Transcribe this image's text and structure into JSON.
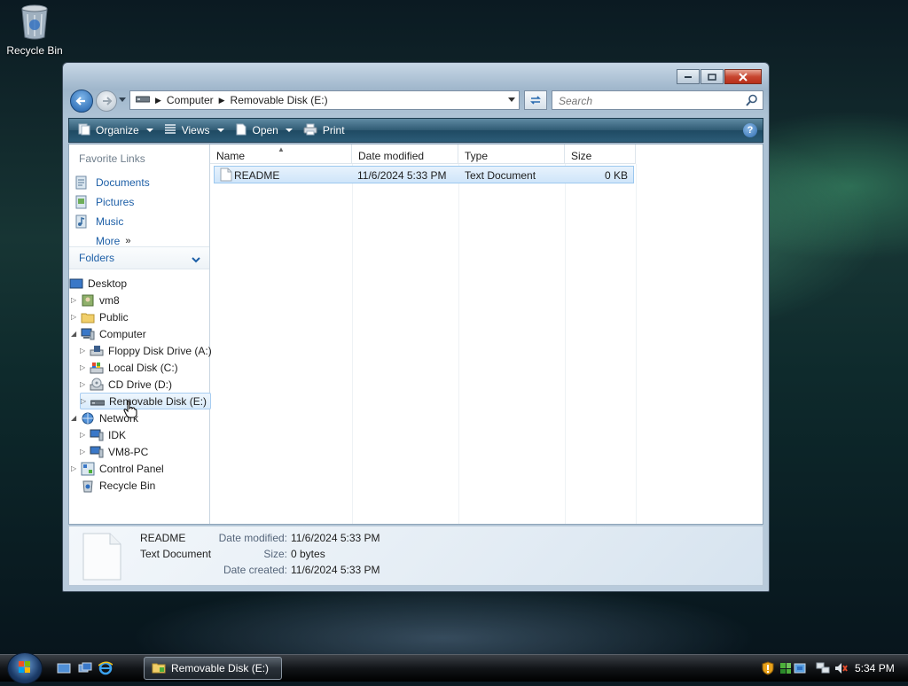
{
  "desktop": {
    "recycle_bin_label": "Recycle Bin"
  },
  "window": {
    "title": "Removable Disk (E:)",
    "breadcrumb": [
      "Computer",
      "Removable Disk (E:)"
    ],
    "search_placeholder": "Search",
    "toolbar": {
      "organize": "Organize",
      "views": "Views",
      "open": "Open",
      "print": "Print"
    },
    "favorite_links": {
      "title": "Favorite Links",
      "items": [
        "Documents",
        "Pictures",
        "Music",
        "More"
      ]
    },
    "folders_label": "Folders",
    "tree": [
      "Desktop",
      "vm8",
      "Public",
      "Computer",
      "Floppy Disk Drive (A:)",
      "Local Disk (C:)",
      "CD Drive (D:)",
      "Removable Disk (E:)",
      "Network",
      "IDK",
      "VM8-PC",
      "Control Panel",
      "Recycle Bin"
    ],
    "columns": {
      "name": "Name",
      "date_modified": "Date modified",
      "type": "Type",
      "size": "Size"
    },
    "files": [
      {
        "name": "README",
        "date_modified": "11/6/2024 5:33 PM",
        "type": "Text Document",
        "size": "0 KB"
      }
    ],
    "details": {
      "name": "README",
      "type": "Text Document",
      "date_modified_label": "Date modified:",
      "date_modified": "11/6/2024 5:33 PM",
      "size_label": "Size:",
      "size": "0 bytes",
      "date_created_label": "Date created:",
      "date_created": "11/6/2024 5:33 PM"
    }
  },
  "taskbar": {
    "task_label": "Removable Disk (E:)",
    "clock": "5:34 PM"
  },
  "colors": {
    "link_blue": "#1d5fa7",
    "command_bar": "#2f5a73",
    "selection": "#cfe5fa"
  }
}
